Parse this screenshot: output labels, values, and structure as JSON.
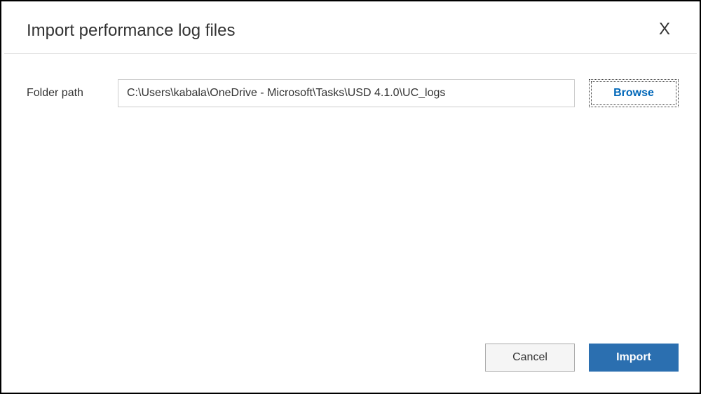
{
  "dialog": {
    "title": "Import performance log files",
    "close_label": "X"
  },
  "form": {
    "folder_path_label": "Folder path",
    "folder_path_value": "C:\\Users\\kabala\\OneDrive - Microsoft\\Tasks\\USD 4.1.0\\UC_logs",
    "browse_label": "Browse"
  },
  "footer": {
    "cancel_label": "Cancel",
    "import_label": "Import"
  }
}
